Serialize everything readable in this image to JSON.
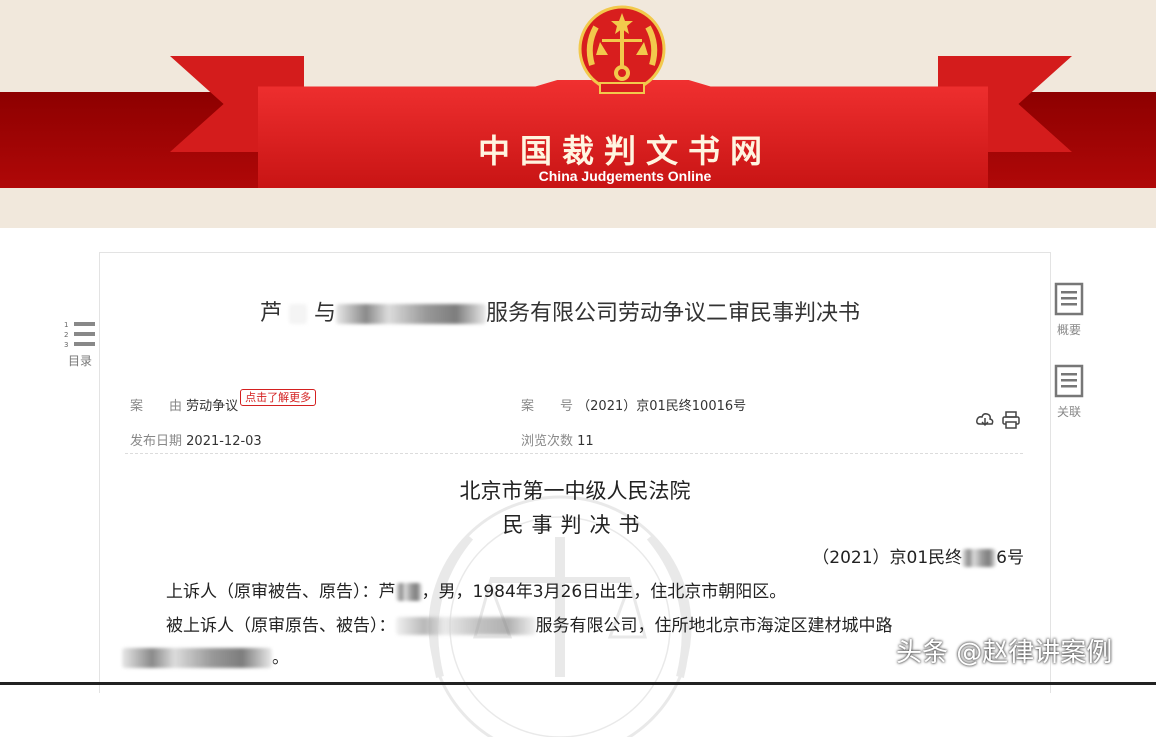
{
  "header": {
    "site_name": "中国裁判文书网",
    "site_name_en": "China Judgements Online"
  },
  "toc": {
    "label": "目录"
  },
  "side_tools": [
    {
      "label": "概要",
      "icon": "summary-doc-icon"
    },
    {
      "label": "关联",
      "icon": "related-doc-icon"
    }
  ],
  "document": {
    "title_prefix": "芦",
    "title_mid": "与",
    "title_suffix": "服务有限公司劳动争议二审民事判决书",
    "meta": {
      "cause_key": "案　　由",
      "cause_value": "劳动争议",
      "learn_more": "点击了解更多",
      "case_no_key": "案　　号",
      "case_no_value": "（2021）京01民终10016号",
      "publish_date_key": "发布日期",
      "publish_date_value": "2021-12-03",
      "views_key": "浏览次数",
      "views_value": "11"
    },
    "court_name": "北京市第一中级人民法院",
    "doc_type": "民事判决书",
    "case_line_prefix": "（2021）京01民终",
    "case_line_suffix": "6号",
    "para1": "上诉人（原审被告、原告）：芦",
    "para1_rest": "，男，1984年3月26日出生，住北京市朝阳区。",
    "para2": "被上诉人（原审原告、被告）：",
    "para2_rest": "服务有限公司，住所地北京市海淀区建材城中路",
    "para3_end": "。"
  },
  "credit": "头条 @赵律讲案例",
  "colors": {
    "brand_red": "#d41c1c",
    "band_dark_red": "#8d0000",
    "banner_bg": "#f1e8dc",
    "tag_red": "#d42020"
  }
}
